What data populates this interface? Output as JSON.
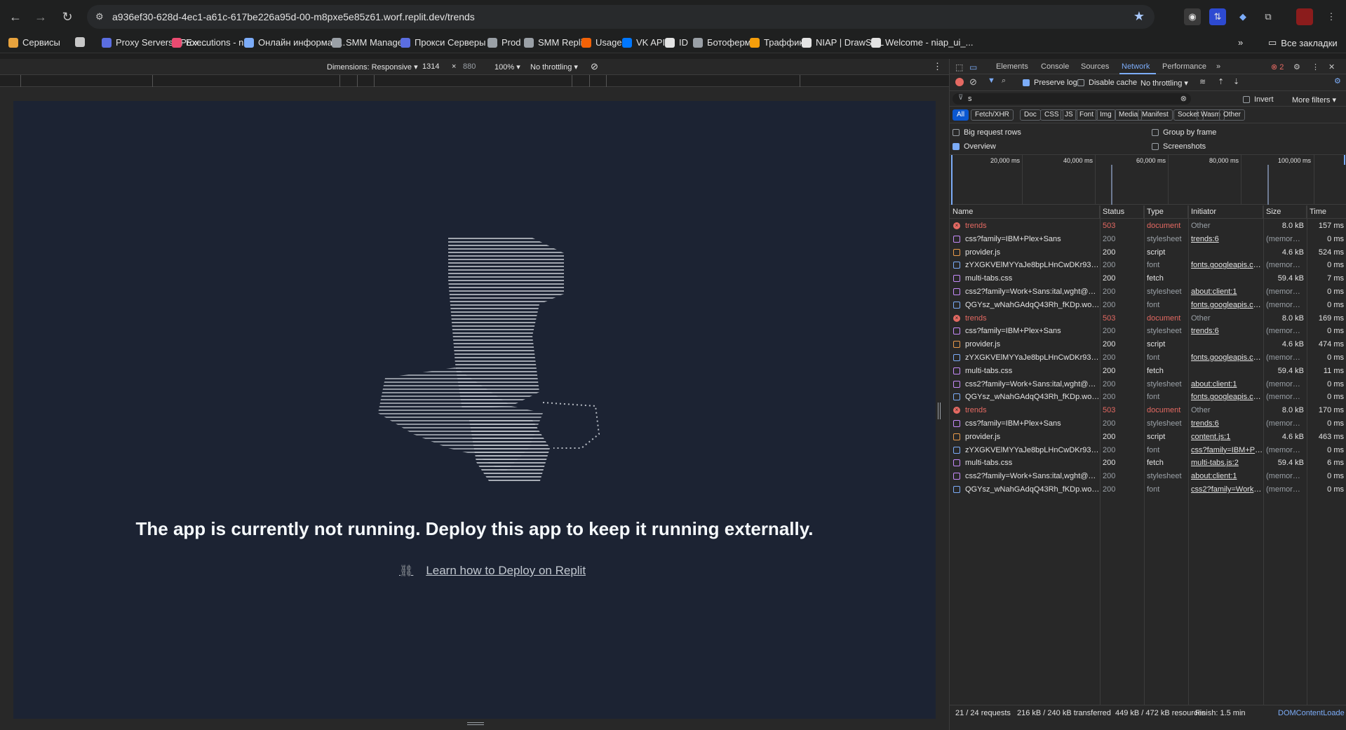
{
  "browser": {
    "url": "a936ef30-628d-4ec1-a61c-617be226a95d-00-m8pxe5e85z61.worf.replit.dev/trends",
    "bookmarks": [
      {
        "label": "Сервисы",
        "icon": "apps-grid-icon",
        "color": "#e8a33d"
      },
      {
        "label": "",
        "icon": "grid-icon",
        "color": "#c7c7c7"
      },
      {
        "label": "Proxy Servers | Prox...",
        "icon": "proxy-icon",
        "color": "#5b6ee1"
      },
      {
        "label": "Executions - n8n",
        "icon": "n8n-icon",
        "color": "#ea4b71"
      },
      {
        "label": "Онлайн информац...",
        "icon": "v-icon",
        "color": "#7cacf8"
      },
      {
        "label": "SMM Manager",
        "icon": "globe-icon",
        "color": "#9aa0a6"
      },
      {
        "label": "Прокси Серверы |...",
        "icon": "proxy-icon",
        "color": "#5b6ee1"
      },
      {
        "label": "Prod",
        "icon": "globe-icon",
        "color": "#9aa0a6"
      },
      {
        "label": "SMM Replit",
        "icon": "globe-icon",
        "color": "#9aa0a6"
      },
      {
        "label": "Usage",
        "icon": "replit-icon",
        "color": "#f26207"
      },
      {
        "label": "VK API",
        "icon": "vk-icon",
        "color": "#0077ff"
      },
      {
        "label": "ID",
        "icon": "r-icon",
        "color": "#e3e3e3"
      },
      {
        "label": "Ботоферма",
        "icon": "globe-icon",
        "color": "#9aa0a6"
      },
      {
        "label": "Траффик",
        "icon": "traffic-icon",
        "color": "#f59e0b"
      },
      {
        "label": "NIAP | DrawSQL",
        "icon": "drawsql-icon",
        "color": "#e3e3e3"
      },
      {
        "label": "Welcome - niap_ui_...",
        "icon": "github-icon",
        "color": "#e3e3e3"
      }
    ],
    "all_bookmarks": "Все закладки",
    "more": "»"
  },
  "device_toolbar": {
    "dimensions": "Dimensions: Responsive",
    "width": "1314",
    "times": "×",
    "height": "880",
    "zoom": "100%",
    "throttling": "No throttling"
  },
  "page": {
    "message": "The app is currently not running. Deploy this app to keep it running externally.",
    "link": "Learn how to Deploy on Replit"
  },
  "devtools": {
    "tabs": [
      "Elements",
      "Console",
      "Sources",
      "Network",
      "Performance"
    ],
    "active_tab": "Network",
    "error_count": "2",
    "toolbar": {
      "preserve_log": "Preserve log",
      "disable_cache": "Disable cache",
      "throttling": "No throttling"
    },
    "filter_value": "s",
    "invert": "Invert",
    "more_filters": "More filters",
    "types": [
      "All",
      "Fetch/XHR",
      "Doc",
      "CSS",
      "JS",
      "Font",
      "Img",
      "Media",
      "Manifest",
      "Socket",
      "Wasm",
      "Other"
    ],
    "options": {
      "big_rows": "Big request rows",
      "group_by_frame": "Group by frame",
      "overview": "Overview",
      "screenshots": "Screenshots"
    },
    "overview_ticks": [
      "20,000 ms",
      "40,000 ms",
      "60,000 ms",
      "80,000 ms",
      "100,000 ms"
    ],
    "columns": [
      "Name",
      "Status",
      "Type",
      "Initiator",
      "Size",
      "Time"
    ],
    "requests": [
      {
        "name": "trends",
        "status": "503",
        "type": "document",
        "initiator": "Other",
        "size": "8.0 kB",
        "time": "157 ms",
        "kind": "err"
      },
      {
        "name": "css?family=IBM+Plex+Sans",
        "status": "200",
        "type": "stylesheet",
        "initiator": "trends:6",
        "size": "(memory ...",
        "time": "0 ms",
        "kind": "css"
      },
      {
        "name": "provider.js",
        "status": "200",
        "type": "script",
        "initiator": "",
        "size": "4.6 kB",
        "time": "524 ms",
        "kind": "js"
      },
      {
        "name": "zYXGKVElMYYaJe8bpLHnCwDKr932-G...",
        "status": "200",
        "type": "font",
        "initiator": "fonts.googleapis.com",
        "size": "(memory ...",
        "time": "0 ms",
        "kind": "font"
      },
      {
        "name": "multi-tabs.css",
        "status": "200",
        "type": "fetch",
        "initiator": "",
        "size": "59.4 kB",
        "time": "7 ms",
        "kind": "fetch"
      },
      {
        "name": "css2?family=Work+Sans:ital,wght@0,...",
        "status": "200",
        "type": "stylesheet",
        "initiator": "about:client:1",
        "size": "(memory ...",
        "time": "0 ms",
        "kind": "css"
      },
      {
        "name": "QGYsz_wNahGAdqQ43Rh_fKDp.woff2",
        "status": "200",
        "type": "font",
        "initiator": "fonts.googleapis.com",
        "size": "(memory ...",
        "time": "0 ms",
        "kind": "font"
      },
      {
        "name": "trends",
        "status": "503",
        "type": "document",
        "initiator": "Other",
        "size": "8.0 kB",
        "time": "169 ms",
        "kind": "err"
      },
      {
        "name": "css?family=IBM+Plex+Sans",
        "status": "200",
        "type": "stylesheet",
        "initiator": "trends:6",
        "size": "(memory ...",
        "time": "0 ms",
        "kind": "css"
      },
      {
        "name": "provider.js",
        "status": "200",
        "type": "script",
        "initiator": "",
        "size": "4.6 kB",
        "time": "474 ms",
        "kind": "js"
      },
      {
        "name": "zYXGKVElMYYaJe8bpLHnCwDKr932-G...",
        "status": "200",
        "type": "font",
        "initiator": "fonts.googleapis.com",
        "size": "(memory ...",
        "time": "0 ms",
        "kind": "font"
      },
      {
        "name": "multi-tabs.css",
        "status": "200",
        "type": "fetch",
        "initiator": "",
        "size": "59.4 kB",
        "time": "11 ms",
        "kind": "fetch"
      },
      {
        "name": "css2?family=Work+Sans:ital,wght@0,...",
        "status": "200",
        "type": "stylesheet",
        "initiator": "about:client:1",
        "size": "(memory ...",
        "time": "0 ms",
        "kind": "css"
      },
      {
        "name": "QGYsz_wNahGAdqQ43Rh_fKDp.woff2",
        "status": "200",
        "type": "font",
        "initiator": "fonts.googleapis.com",
        "size": "(memory ...",
        "time": "0 ms",
        "kind": "font"
      },
      {
        "name": "trends",
        "status": "503",
        "type": "document",
        "initiator": "Other",
        "size": "8.0 kB",
        "time": "170 ms",
        "kind": "err"
      },
      {
        "name": "css?family=IBM+Plex+Sans",
        "status": "200",
        "type": "stylesheet",
        "initiator": "trends:6",
        "size": "(memory ...",
        "time": "0 ms",
        "kind": "css"
      },
      {
        "name": "provider.js",
        "status": "200",
        "type": "script",
        "initiator": "content.js:1",
        "size": "4.6 kB",
        "time": "463 ms",
        "kind": "js"
      },
      {
        "name": "zYXGKVElMYYaJe8bpLHnCwDKr932-G...",
        "status": "200",
        "type": "font",
        "initiator": "css?family=IBM+Plex",
        "size": "(memory ...",
        "time": "0 ms",
        "kind": "font"
      },
      {
        "name": "multi-tabs.css",
        "status": "200",
        "type": "fetch",
        "initiator": "multi-tabs.js:2",
        "size": "59.4 kB",
        "time": "6 ms",
        "kind": "fetch"
      },
      {
        "name": "css2?family=Work+Sans:ital,wght@0,...",
        "status": "200",
        "type": "stylesheet",
        "initiator": "about:client:1",
        "size": "(memory ...",
        "time": "0 ms",
        "kind": "css"
      },
      {
        "name": "QGYsz_wNahGAdqQ43Rh_fKDp.woff2",
        "status": "200",
        "type": "font",
        "initiator": "css2?family=Work+S",
        "size": "(memory ...",
        "time": "0 ms",
        "kind": "font"
      }
    ],
    "statusbar": {
      "requests": "21 / 24 requests",
      "transferred": "216 kB / 240 kB transferred",
      "resources": "449 kB / 472 kB resources",
      "finish": "Finish: 1.5 min",
      "dcl": "DOMContentLoade"
    }
  }
}
